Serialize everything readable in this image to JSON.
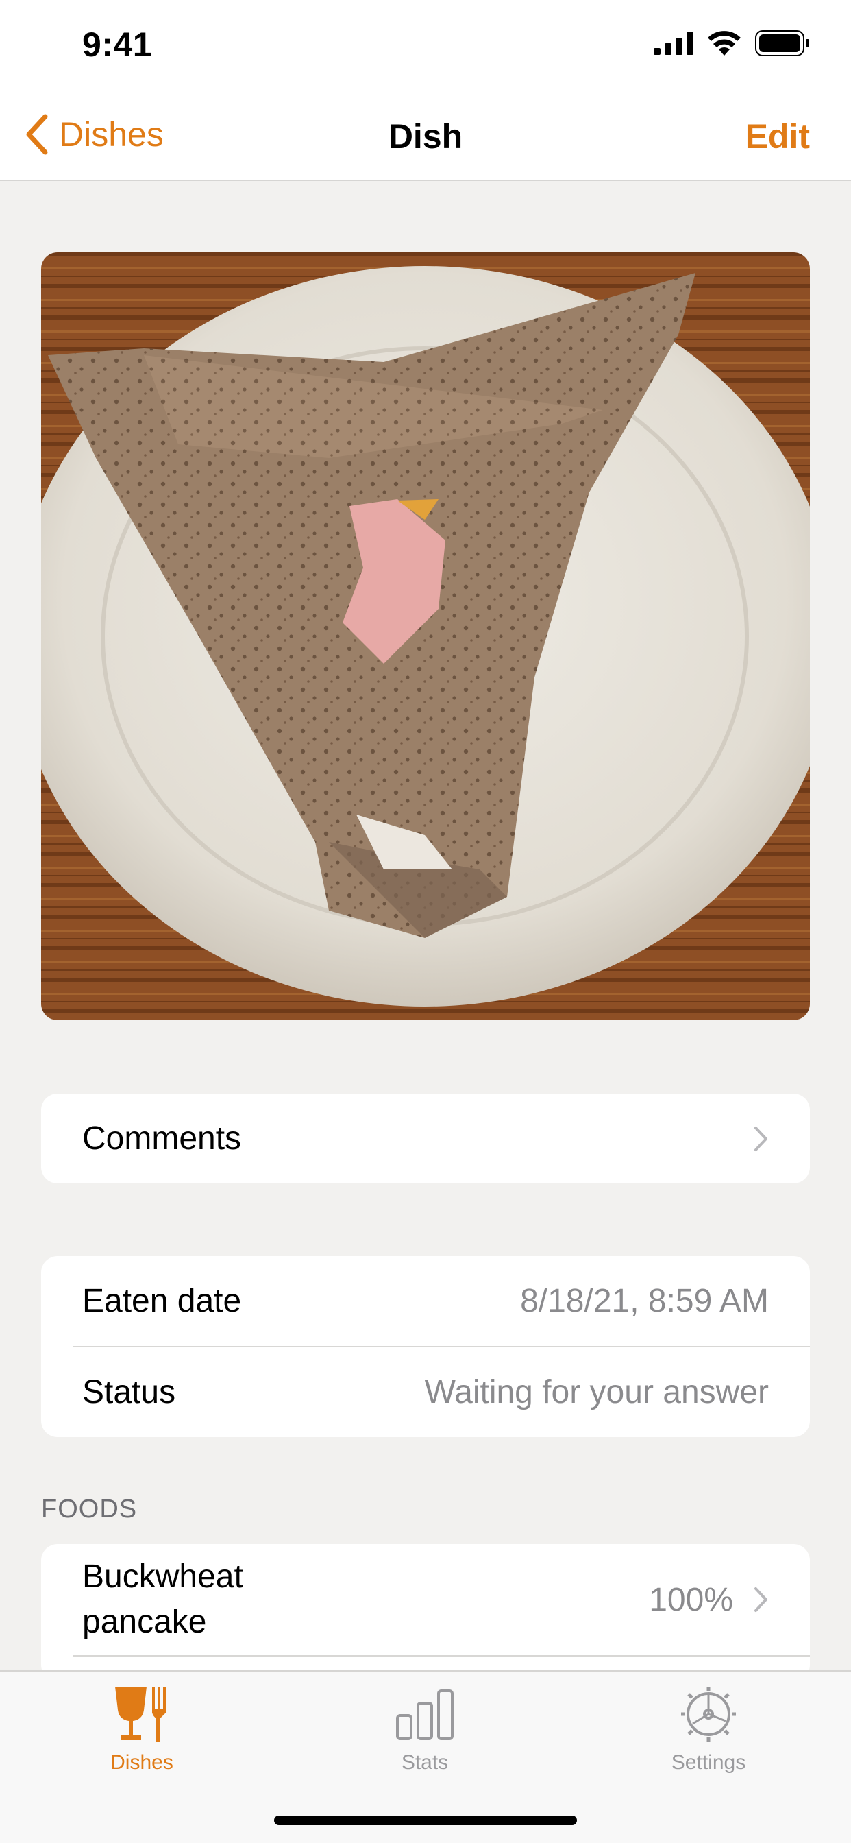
{
  "status_bar": {
    "time": "9:41"
  },
  "nav": {
    "back_label": "Dishes",
    "title": "Dish",
    "edit_label": "Edit"
  },
  "comments": {
    "label": "Comments"
  },
  "details": {
    "eaten_date_label": "Eaten date",
    "eaten_date_value": "8/18/21, 8:59 AM",
    "status_label": "Status",
    "status_value": "Waiting for your answer"
  },
  "foods": {
    "header": "FOODS",
    "items": [
      {
        "name": "Buckwheat pancake",
        "percent": "100%"
      }
    ]
  },
  "tab_bar": {
    "tabs": [
      {
        "label": "Dishes",
        "icon": "glass-fork-icon",
        "active": true
      },
      {
        "label": "Stats",
        "icon": "bar-chart-icon",
        "active": false
      },
      {
        "label": "Settings",
        "icon": "gear-icon",
        "active": false
      }
    ]
  },
  "colors": {
    "accent": "#e07b16",
    "background": "#f2f1ef",
    "secondary_text": "#8a8a8d"
  }
}
